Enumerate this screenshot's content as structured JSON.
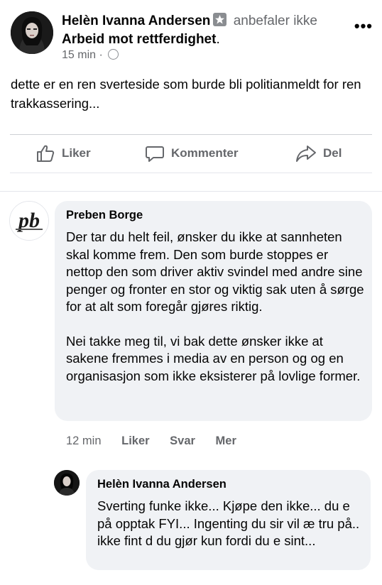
{
  "post": {
    "author": "Helèn Ivanna Andersen",
    "verb": "anbefaler ikke",
    "page": "Arbeid mot rettferdighet",
    "time": "15 min",
    "separator": "·",
    "more": "•••",
    "text": "dette er en ren sverteside som burde bli politianmeldt for ren trakkassering...",
    "actions": {
      "like": "Liker",
      "comment": "Kommenter",
      "share": "Del"
    }
  },
  "comments": [
    {
      "author": "Preben Borge",
      "avatar_initials": "pb",
      "paragraphs": [
        "Der tar du helt feil, ønsker du ikke at sannheten skal komme frem. Den som burde stoppes er nettop den som driver aktiv svindel med andre sine penger og fronter en stor og viktig sak uten å sørge for at alt som foregår gjøres riktig.",
        "Nei takke meg til, vi bak dette ønsker ikke at sakene fremmes i media av en person og og en organisasjon som ikke eksisterer på lovlige former."
      ],
      "time": "12 min",
      "like": "Liker",
      "reply": "Svar",
      "more": "Mer"
    },
    {
      "author": "Helèn Ivanna Andersen",
      "paragraphs": [
        "Sverting funke ikke... Kjøpe den ikke... du e på opptak FYI... Ingenting du sir vil æ tru på.. ikke fint d du gjør kun fordi du e sint..."
      ]
    }
  ],
  "colors": {
    "bubble": "#f0f2f5",
    "muted": "#65676b",
    "text": "#050505"
  }
}
